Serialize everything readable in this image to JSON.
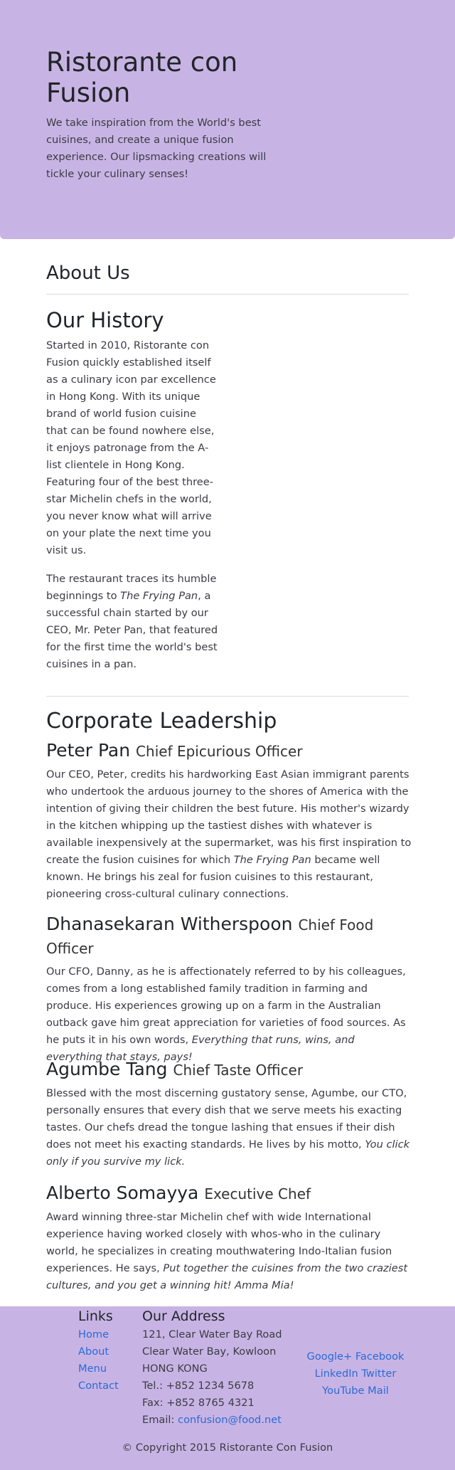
{
  "header": {
    "title": "Ristorante con Fusion",
    "tagline": "We take inspiration from the World's best cuisines, and create a unique fusion experience. Our lipsmacking creations will tickle your culinary senses!"
  },
  "about": {
    "title": "About Us",
    "history_title": "Our History",
    "history_p1": "Started in 2010, Ristorante con Fusion quickly established itself as a culinary icon par excellence in Hong Kong. With its unique brand of world fusion cuisine that can be found nowhere else, it enjoys patronage from the A-list clientele in Hong Kong. Featuring four of the best three-star Michelin chefs in the world, you never know what will arrive on your plate the next time you visit us.",
    "history_p2_a": "The restaurant traces its humble beginnings to ",
    "history_p2_em": "The Frying Pan",
    "history_p2_b": ", a successful chain started by our CEO, Mr. Peter Pan, that featured for the first time the world's best cuisines in a pan."
  },
  "leadership": {
    "title": "Corporate Leadership",
    "leaders": [
      {
        "name": "Peter Pan",
        "role": "Chief Epicurious Officer",
        "text_a": "Our CEO, Peter, credits his hardworking East Asian immigrant parents who undertook the arduous journey to the shores of America with the intention of giving their children the best future. His mother's wizardy in the kitchen whipping up the tastiest dishes with whatever is available inexpensively at the supermarket, was his first inspiration to create the fusion cuisines for which ",
        "text_em": "The Frying Pan",
        "text_b": " became well known. He brings his zeal for fusion cuisines to this restaurant, pioneering cross-cultural culinary connections."
      },
      {
        "name": "Dhanasekaran Witherspoon",
        "role": "Chief Food Officer",
        "text_a": "Our CFO, Danny, as he is affectionately referred to by his colleagues, comes from a long established family tradition in farming and produce. His experiences growing up on a farm in the Australian outback gave him great appreciation for varieties of food sources. As he puts it in his own words, ",
        "text_em": "Everything that runs, wins, and everything that stays, pays!",
        "text_b": ""
      },
      {
        "name": "Agumbe Tang",
        "role": "Chief Taste Officer",
        "text_a": "Blessed with the most discerning gustatory sense, Agumbe, our CTO, personally ensures that every dish that we serve meets his exacting tastes. Our chefs dread the tongue lashing that ensues if their dish does not meet his exacting standards. He lives by his motto, ",
        "text_em": "You click only if you survive my lick.",
        "text_b": ""
      },
      {
        "name": "Alberto Somayya",
        "role": "Executive Chef",
        "text_a": "Award winning three-star Michelin chef with wide International experience having worked closely with whos-who in the culinary world, he specializes in creating mouthwatering Indo-Italian fusion experiences. He says, ",
        "text_em": "Put together the cuisines from the two craziest cultures, and you get a winning hit! Amma Mia!",
        "text_b": ""
      }
    ]
  },
  "footer": {
    "links_title": "Links",
    "links": [
      "Home",
      "About",
      "Menu",
      "Contact"
    ],
    "address_title": "Our Address",
    "address_line1": "121, Clear Water Bay Road",
    "address_line2": "Clear Water Bay, Kowloon",
    "address_line3": "HONG KONG",
    "tel": "Tel.: +852 1234 5678",
    "fax": "Fax: +852 8765 4321",
    "email_label": "Email: ",
    "email": "confusion@food.net",
    "social": [
      "Google+",
      "Facebook",
      "LinkedIn",
      "Twitter",
      "YouTube",
      "Mail"
    ],
    "copyright": "© Copyright 2015 Ristorante Con Fusion"
  },
  "colors": {
    "accent": "#c8b4e4",
    "link": "#2a6ad8"
  }
}
